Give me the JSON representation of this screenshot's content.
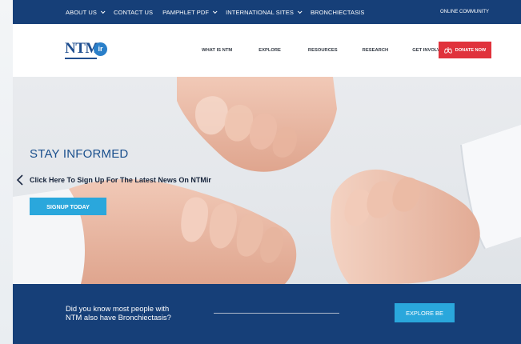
{
  "topbar": {
    "items": [
      {
        "label": "ABOUT US",
        "dropdown": true
      },
      {
        "label": "CONTACT US",
        "dropdown": false
      },
      {
        "label": "PAMPHLET PDF",
        "dropdown": true
      },
      {
        "label": "INTERNATIONAL SITES",
        "dropdown": true
      },
      {
        "label": "BRONCHIECTASIS",
        "dropdown": false
      }
    ],
    "community": "ONLINE COMMUNITY"
  },
  "header": {
    "logo_text": "NTM",
    "logo_badge": "ir",
    "nav": [
      "WHAT IS NTM",
      "EXPLORE",
      "RESOURCES",
      "RESEARCH",
      "GET INVOLVED"
    ],
    "donate_label": "DONATE NOW"
  },
  "hero": {
    "title": "STAY INFORMED",
    "subtitle": "Click Here To Sign Up For The Latest News On NTMir",
    "cta": "SIGNUP TODAY"
  },
  "band": {
    "line1": "Did you know most people with",
    "line2": "NTM also have Bronchiectasis?",
    "cta": "EXPLORE BE"
  },
  "colors": {
    "navy": "#163f78",
    "accent_blue": "#2aa7dc",
    "donate_red": "#e0323c",
    "title_blue": "#1a4f8d"
  },
  "icons": {
    "donate": "lungs-icon",
    "carousel_prev": "chevron-left-icon",
    "dropdown": "chevron-down-icon"
  }
}
